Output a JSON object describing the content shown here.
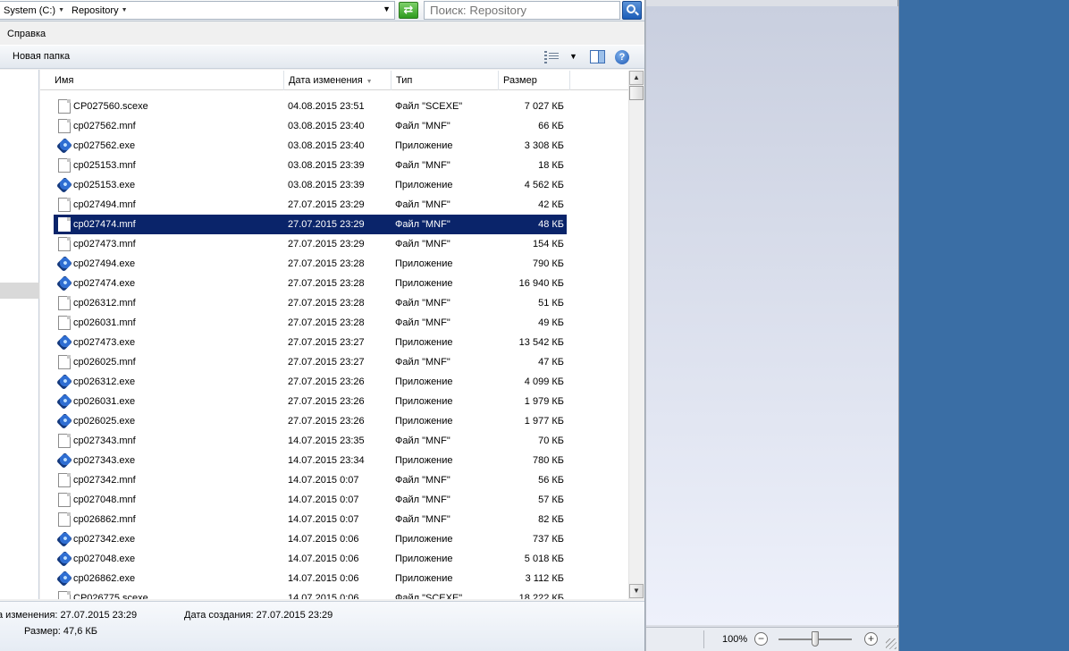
{
  "address_bar": {
    "breadcrumbs": [
      {
        "label": "System (C:)"
      },
      {
        "label": "Repository"
      }
    ],
    "search_placeholder": "Поиск: Repository"
  },
  "menu": {
    "items": [
      "Справка"
    ]
  },
  "toolbar": {
    "new_folder_label": "Новая папка"
  },
  "columns": {
    "name": "Имя",
    "date": "Дата изменения",
    "type": "Тип",
    "size": "Размер"
  },
  "files": [
    {
      "name": "CP027560.scexe",
      "date": "04.08.2015 23:51",
      "type": "Файл \"SCEXE\"",
      "size": "7 027 КБ",
      "icon": "document-icon"
    },
    {
      "name": "cp027562.mnf",
      "date": "03.08.2015 23:40",
      "type": "Файл \"MNF\"",
      "size": "66 КБ",
      "icon": "document-icon"
    },
    {
      "name": "cp027562.exe",
      "date": "03.08.2015 23:40",
      "type": "Приложение",
      "size": "3 308 КБ",
      "icon": "application-icon"
    },
    {
      "name": "cp025153.mnf",
      "date": "03.08.2015 23:39",
      "type": "Файл \"MNF\"",
      "size": "18 КБ",
      "icon": "document-icon"
    },
    {
      "name": "cp025153.exe",
      "date": "03.08.2015 23:39",
      "type": "Приложение",
      "size": "4 562 КБ",
      "icon": "application-icon"
    },
    {
      "name": "cp027494.mnf",
      "date": "27.07.2015 23:29",
      "type": "Файл \"MNF\"",
      "size": "42 КБ",
      "icon": "document-icon"
    },
    {
      "name": "cp027474.mnf",
      "date": "27.07.2015 23:29",
      "type": "Файл \"MNF\"",
      "size": "48 КБ",
      "icon": "document-icon",
      "selected": true
    },
    {
      "name": "cp027473.mnf",
      "date": "27.07.2015 23:29",
      "type": "Файл \"MNF\"",
      "size": "154 КБ",
      "icon": "document-icon"
    },
    {
      "name": "cp027494.exe",
      "date": "27.07.2015 23:28",
      "type": "Приложение",
      "size": "790 КБ",
      "icon": "application-icon"
    },
    {
      "name": "cp027474.exe",
      "date": "27.07.2015 23:28",
      "type": "Приложение",
      "size": "16 940 КБ",
      "icon": "application-icon"
    },
    {
      "name": "cp026312.mnf",
      "date": "27.07.2015 23:28",
      "type": "Файл \"MNF\"",
      "size": "51 КБ",
      "icon": "document-icon"
    },
    {
      "name": "cp026031.mnf",
      "date": "27.07.2015 23:28",
      "type": "Файл \"MNF\"",
      "size": "49 КБ",
      "icon": "document-icon"
    },
    {
      "name": "cp027473.exe",
      "date": "27.07.2015 23:27",
      "type": "Приложение",
      "size": "13 542 КБ",
      "icon": "application-icon"
    },
    {
      "name": "cp026025.mnf",
      "date": "27.07.2015 23:27",
      "type": "Файл \"MNF\"",
      "size": "47 КБ",
      "icon": "document-icon"
    },
    {
      "name": "cp026312.exe",
      "date": "27.07.2015 23:26",
      "type": "Приложение",
      "size": "4 099 КБ",
      "icon": "application-icon"
    },
    {
      "name": "cp026031.exe",
      "date": "27.07.2015 23:26",
      "type": "Приложение",
      "size": "1 979 КБ",
      "icon": "application-icon"
    },
    {
      "name": "cp026025.exe",
      "date": "27.07.2015 23:26",
      "type": "Приложение",
      "size": "1 977 КБ",
      "icon": "application-icon"
    },
    {
      "name": "cp027343.mnf",
      "date": "14.07.2015 23:35",
      "type": "Файл \"MNF\"",
      "size": "70 КБ",
      "icon": "document-icon"
    },
    {
      "name": "cp027343.exe",
      "date": "14.07.2015 23:34",
      "type": "Приложение",
      "size": "780 КБ",
      "icon": "application-icon"
    },
    {
      "name": "cp027342.mnf",
      "date": "14.07.2015 0:07",
      "type": "Файл \"MNF\"",
      "size": "56 КБ",
      "icon": "document-icon"
    },
    {
      "name": "cp027048.mnf",
      "date": "14.07.2015 0:07",
      "type": "Файл \"MNF\"",
      "size": "57 КБ",
      "icon": "document-icon"
    },
    {
      "name": "cp026862.mnf",
      "date": "14.07.2015 0:07",
      "type": "Файл \"MNF\"",
      "size": "82 КБ",
      "icon": "document-icon"
    },
    {
      "name": "cp027342.exe",
      "date": "14.07.2015 0:06",
      "type": "Приложение",
      "size": "737 КБ",
      "icon": "application-icon"
    },
    {
      "name": "cp027048.exe",
      "date": "14.07.2015 0:06",
      "type": "Приложение",
      "size": "5 018 КБ",
      "icon": "application-icon"
    },
    {
      "name": "cp026862.exe",
      "date": "14.07.2015 0:06",
      "type": "Приложение",
      "size": "3 112 КБ",
      "icon": "application-icon"
    },
    {
      "name": "CP026775.scexe",
      "date": "14.07.2015 0:06",
      "type": "Файл \"SCEXE\"",
      "size": "18 222 КБ",
      "icon": "document-icon"
    }
  ],
  "details": {
    "modified": "а изменения: 27.07.2015 23:29",
    "created": "Дата создания: 27.07.2015 23:29",
    "size": "Размер: 47,6 КБ"
  },
  "preview": {
    "zoom_level": "100%"
  },
  "colors": {
    "selection": "#0a246a",
    "desktop": "#3a6ea5"
  }
}
